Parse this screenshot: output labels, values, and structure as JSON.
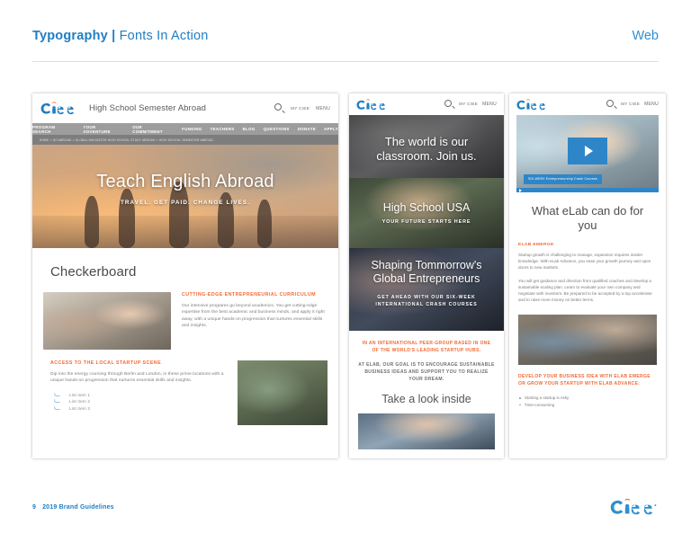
{
  "header": {
    "title_bold": "Typography",
    "title_sep": " | ",
    "title_light": "Fonts In Action",
    "right_label": "Web"
  },
  "footer": {
    "page_number": "9",
    "label": "2019 Brand Guidelines",
    "logo_alt": "ciee-logo"
  },
  "mockups": {
    "desktop": {
      "logo_alt": "ciee-logo",
      "site_title": "High School Semester Abroad",
      "search_icon": "search-icon",
      "my_ciee": "MY CIEE",
      "menu_label": "MENU",
      "nav_items": [
        "PROGRAM SEARCH",
        "YOUR ADVENTURE",
        "OUR COMMITMENT",
        "FUNDING",
        "TEACHERS",
        "BLOG",
        "QUESTIONS",
        "DONATE",
        "APPLY"
      ],
      "breadcrumb": "HOME > GO ABROAD > GLOBAL NAVIGATOR HIGH SCHOOL STUDY ABROAD > HIGH SCHOOL SEMESTER ABROAD",
      "hero_heading": "Teach English Abroad",
      "hero_sub": "TRAVEL. GET PAID. CHANGE LIVES.",
      "section_heading": "Checkerboard",
      "block1": {
        "kicker": "CUTTING-EDGE ENTREPRENEURIAL CURRICULUM",
        "body": "Our intensive programs go beyond academics. You get cutting-edge expertise from the best academic and business minds, and apply it right away, with a unique hands-on progression that nurtures essential skills and insights."
      },
      "block2": {
        "kicker": "ACCESS TO THE LOCAL STARTUP SCENE",
        "body": "Dip into the energy coursing through Berlin and London, in these prime locations with a unique hands-on progression that nurtures essential skills and insights.",
        "list": [
          "List item 1",
          "List item 2",
          "List item 3"
        ]
      }
    },
    "middle": {
      "logo_alt": "ciee-logo",
      "search_icon": "search-icon",
      "my_ciee": "MY CIEE",
      "menu_label": "MENU",
      "panels": [
        {
          "heading": "The world is our classroom. Join us.",
          "sub": ""
        },
        {
          "heading": "High School USA",
          "sub": "YOUR FUTURE STARTS HERE"
        },
        {
          "heading": "Shaping Tommorrow's Global Entrepreneurs",
          "sub": "GET AHEAD WITH OUR SIX-WEEK INTERNATIONAL CRASH COURSES"
        }
      ],
      "orange_text": "IN AN INTERNATIONAL PEER-GROUP BASED IN ONE OF THE WORLD'S LEADING STARTUP HUBS.",
      "grey_text": "AT ELAB, OUR GOAL IS TO ENCOURAGE SUSTAINABLE BUSINESS IDEAS AND SUPPORT YOU TO REALIZE YOUR DREAM.",
      "take_a_look": "Take a look inside"
    },
    "right": {
      "logo_alt": "ciee-logo",
      "search_icon": "search-icon",
      "my_ciee": "MY CIEE",
      "menu_label": "MENU",
      "play_icon": "play-icon",
      "video_caption": "SIX-WEEK Entrepreneurship Crash Courses",
      "heading": "What eLab can do for you",
      "kicker": "ELAB EMERGE",
      "para1": "Startup growth is challenging to manage, expansion requires insider knowledge. With eLab Advance, you ease your growth journey and open doors to new markets.",
      "para2": "You will get guidance and direction from qualified coaches and develop a sustainable scaling plan. Learn to evaluate your own company and negotiate with investors. Be prepared to be accepted by a top accelerator and to raise more money on better terms.",
      "cta": "DEVELOP YOUR BUSINESS IDEA WITH ELAB EMERGE OR GROW YOUR STARTUP WITH ELAB ADVANCE:",
      "bullets": [
        "Starting a startup is risky",
        "Time-consuming"
      ]
    }
  },
  "colors": {
    "brand_blue": "#1f7ec2",
    "accent_orange": "#f26a35",
    "rule": "#f4d9c8",
    "grey_text": "#7b7b7b"
  }
}
